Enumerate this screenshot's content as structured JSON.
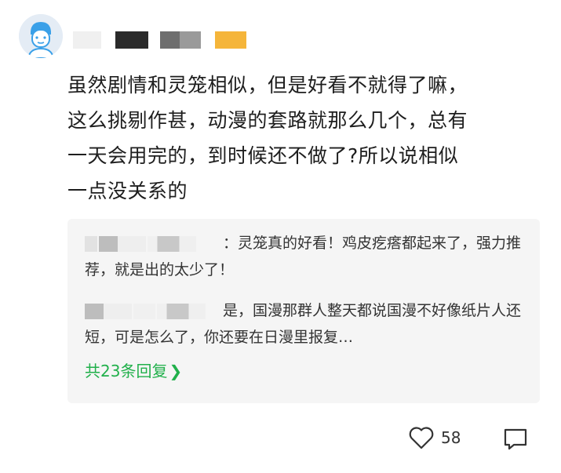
{
  "comment": {
    "text_lines": [
      "虽然剧情和灵笼相似，但是好看不就得了嘛，",
      "这么挑剔作甚，动漫的套路就那么几个，总有",
      "一天会用完的，到时候还不做了?所以说相似",
      "一点没关系的"
    ]
  },
  "replies": [
    {
      "text": "：灵笼真的好看！鸡皮疙瘩都起来了，强力推荐，就是出的太少了！"
    },
    {
      "text": "是，国漫那群人整天都说国漫不好像纸片人还短，可是怎么了，你还要在日漫里报复…"
    }
  ],
  "more_replies": {
    "label": "共23条回复",
    "chevron": "❯"
  },
  "actions": {
    "like_count": "58",
    "like_icon": "heart-outline-icon",
    "comment_icon": "comment-bubble-icon"
  },
  "colors": {
    "accent_green": "#21b04b",
    "reply_bg": "#f5f5f5"
  }
}
